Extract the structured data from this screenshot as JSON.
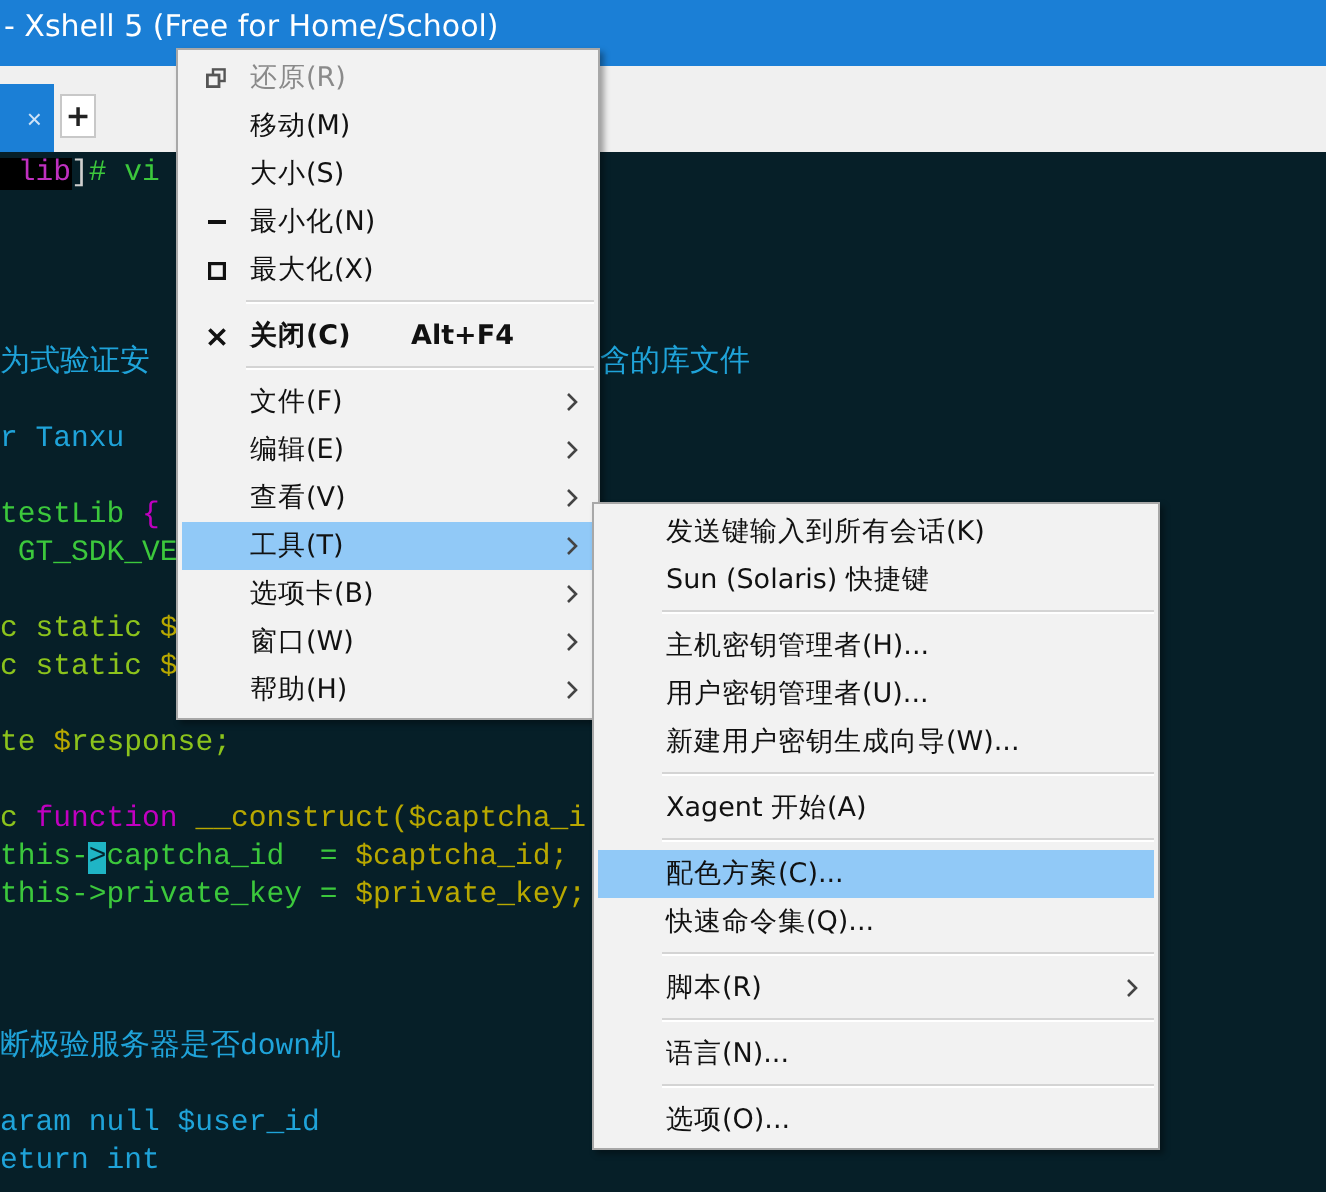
{
  "window": {
    "title": "- Xshell 5 (Free for Home/School)"
  },
  "tabs": [
    {
      "close": "×",
      "selected": true
    }
  ],
  "new_tab_button": {
    "label": "+"
  },
  "terminal": {
    "lines": [
      {
        "kind": "code",
        "segments": [
          {
            "text": " lib",
            "kind": "prompt"
          },
          {
            "text": "]",
            "color": "#d0d0d0"
          },
          {
            "text": "# vi",
            "color": "#3cc83c"
          }
        ]
      },
      {
        "kind": "blank"
      },
      {
        "kind": "blank"
      },
      {
        "kind": "blank"
      },
      {
        "kind": "blank"
      },
      {
        "kind": "split",
        "segments": [
          {
            "text": "为式验证安",
            "color": "#1fa3d9"
          },
          {
            "text": "含的库文件",
            "color": "#1fa3d9"
          }
        ]
      },
      {
        "kind": "blank"
      },
      {
        "kind": "code",
        "segments": [
          {
            "text": "r Tanxu",
            "color": "#1fa3d9"
          }
        ]
      },
      {
        "kind": "blank"
      },
      {
        "kind": "code",
        "segments": [
          {
            "text": "testLib ",
            "color": "#3cc83c"
          },
          {
            "text": "{",
            "color": "#c000c0"
          }
        ]
      },
      {
        "kind": "code",
        "segments": [
          {
            "text": " GT_SDK_VE",
            "color": "#3cc83c"
          }
        ]
      },
      {
        "kind": "blank"
      },
      {
        "kind": "code",
        "segments": [
          {
            "text": "c static ",
            "color": "#8cc31c"
          },
          {
            "text": "$",
            "color": "#b8a800"
          }
        ]
      },
      {
        "kind": "code",
        "segments": [
          {
            "text": "c static ",
            "color": "#8cc31c"
          },
          {
            "text": "$",
            "color": "#b8a800"
          }
        ]
      },
      {
        "kind": "blank"
      },
      {
        "kind": "code",
        "segments": [
          {
            "text": "te ",
            "color": "#8cc31c"
          },
          {
            "text": "$",
            "color": "#b8a800"
          },
          {
            "text": "response;",
            "color": "#8cc31c"
          }
        ]
      },
      {
        "kind": "blank"
      },
      {
        "kind": "code",
        "segments": [
          {
            "text": "c ",
            "color": "#8cc31c"
          },
          {
            "text": "function",
            "color": "#c000c0"
          },
          {
            "text": " __construct(",
            "color": "#b8a800"
          },
          {
            "text": "$captcha_i",
            "color": "#b8a800"
          }
        ]
      },
      {
        "kind": "code",
        "segments": [
          {
            "text": "this-",
            "color": "#3cc83c"
          },
          {
            "text": ">",
            "kind": "cursor"
          },
          {
            "text": "captcha_id  = ",
            "color": "#3cc83c"
          },
          {
            "text": "$captcha_id;",
            "color": "#b8a800"
          }
        ]
      },
      {
        "kind": "code",
        "segments": [
          {
            "text": "this->private_key = ",
            "color": "#3cc83c"
          },
          {
            "text": "$private_key;",
            "color": "#b8a800"
          }
        ]
      },
      {
        "kind": "blank"
      },
      {
        "kind": "blank"
      },
      {
        "kind": "blank"
      },
      {
        "kind": "code",
        "segments": [
          {
            "text": "断极验服务器是否down机",
            "color": "#1fa3d9"
          }
        ]
      },
      {
        "kind": "blank"
      },
      {
        "kind": "code",
        "segments": [
          {
            "text": "aram null $user_id",
            "color": "#1fa3d9"
          }
        ]
      },
      {
        "kind": "code",
        "segments": [
          {
            "text": "eturn int",
            "color": "#1fa3d9"
          }
        ]
      }
    ]
  },
  "system_menu": {
    "items": [
      {
        "kind": "restore",
        "label": "还原(R)",
        "disabled": true,
        "selected": false,
        "default": false,
        "submenu": false
      },
      {
        "kind": "item",
        "label": "移动(M)",
        "disabled": false,
        "selected": false,
        "default": false,
        "submenu": false
      },
      {
        "kind": "item",
        "label": "大小(S)",
        "disabled": false,
        "selected": false,
        "default": false,
        "submenu": false
      },
      {
        "kind": "minimize",
        "label": "最小化(N)",
        "disabled": false,
        "selected": false,
        "default": false,
        "submenu": false
      },
      {
        "kind": "maximize",
        "label": "最大化(X)",
        "disabled": false,
        "selected": false,
        "default": false,
        "submenu": false
      },
      {
        "kind": "separator"
      },
      {
        "kind": "close",
        "label": "关闭(C)",
        "shortcut": "Alt+F4",
        "disabled": false,
        "selected": false,
        "default": true,
        "submenu": false
      },
      {
        "kind": "separator"
      },
      {
        "kind": "item",
        "label": "文件(F)",
        "disabled": false,
        "selected": false,
        "default": false,
        "submenu": true
      },
      {
        "kind": "item",
        "label": "编辑(E)",
        "disabled": false,
        "selected": false,
        "default": false,
        "submenu": true
      },
      {
        "kind": "item",
        "label": "查看(V)",
        "disabled": false,
        "selected": false,
        "default": false,
        "submenu": true
      },
      {
        "kind": "item",
        "label": "工具(T)",
        "disabled": false,
        "selected": true,
        "default": false,
        "submenu": true
      },
      {
        "kind": "item",
        "label": "选项卡(B)",
        "disabled": false,
        "selected": false,
        "default": false,
        "submenu": true
      },
      {
        "kind": "item",
        "label": "窗口(W)",
        "disabled": false,
        "selected": false,
        "default": false,
        "submenu": true
      },
      {
        "kind": "item",
        "label": "帮助(H)",
        "disabled": false,
        "selected": false,
        "default": false,
        "submenu": true
      }
    ]
  },
  "tools_submenu": {
    "items": [
      {
        "kind": "item",
        "label": "发送键输入到所有会话(K)",
        "disabled": false,
        "selected": false,
        "default": false,
        "submenu": false
      },
      {
        "kind": "item",
        "label": "Sun (Solaris) 快捷键",
        "disabled": false,
        "selected": false,
        "default": false,
        "submenu": false
      },
      {
        "kind": "separator"
      },
      {
        "kind": "item",
        "label": "主机密钥管理者(H)...",
        "disabled": false,
        "selected": false,
        "default": false,
        "submenu": false
      },
      {
        "kind": "item",
        "label": "用户密钥管理者(U)...",
        "disabled": false,
        "selected": false,
        "default": false,
        "submenu": false
      },
      {
        "kind": "item",
        "label": "新建用户密钥生成向导(W)...",
        "disabled": false,
        "selected": false,
        "default": false,
        "submenu": false
      },
      {
        "kind": "separator"
      },
      {
        "kind": "item",
        "label": "Xagent 开始(A)",
        "disabled": false,
        "selected": false,
        "default": false,
        "submenu": false
      },
      {
        "kind": "separator"
      },
      {
        "kind": "item",
        "label": "配色方案(C)...",
        "disabled": false,
        "selected": true,
        "default": false,
        "submenu": false
      },
      {
        "kind": "item",
        "label": "快速命令集(Q)...",
        "disabled": false,
        "selected": false,
        "default": false,
        "submenu": false
      },
      {
        "kind": "separator"
      },
      {
        "kind": "item",
        "label": "脚本(R)",
        "disabled": false,
        "selected": false,
        "default": false,
        "submenu": true
      },
      {
        "kind": "separator"
      },
      {
        "kind": "item",
        "label": "语言(N)...",
        "disabled": false,
        "selected": false,
        "default": false,
        "submenu": false
      },
      {
        "kind": "separator"
      },
      {
        "kind": "item",
        "label": "选项(O)...",
        "disabled": false,
        "selected": false,
        "default": false,
        "submenu": false
      }
    ]
  }
}
